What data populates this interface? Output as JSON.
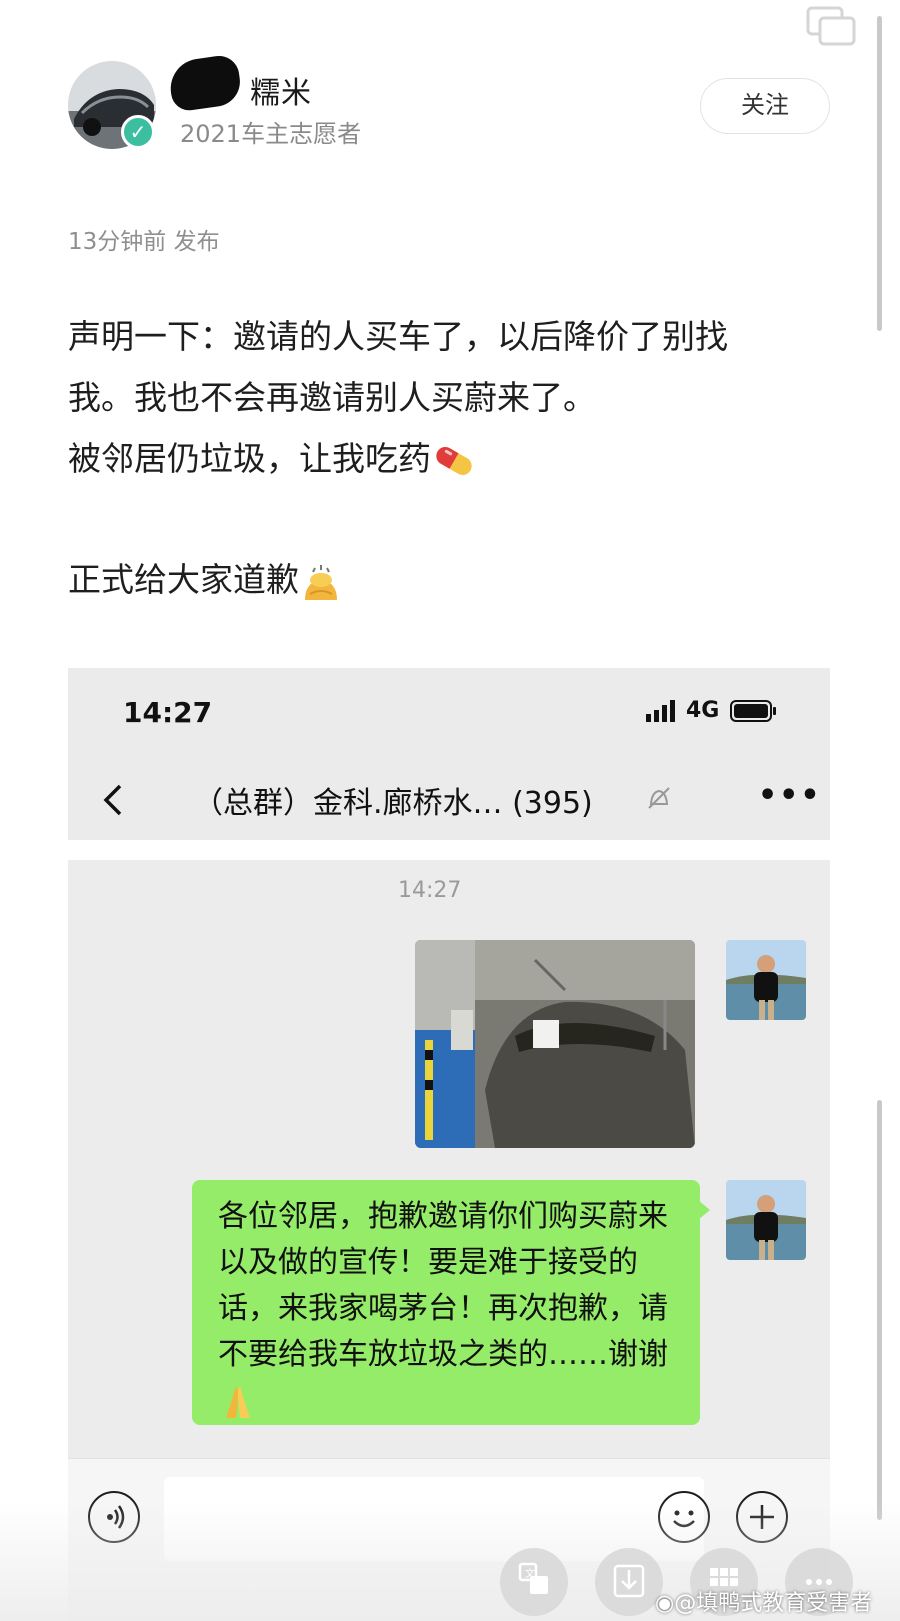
{
  "author": {
    "name_visible": "糯米",
    "subtitle": "2021车主志愿者",
    "follow_label": "关注"
  },
  "post": {
    "time": "13分钟前 发布",
    "lines": [
      "声明一下：邀请的人买车了，以后降价了别找",
      "我。我也不会再邀请别人买蔚来了。",
      "被邻居仍垃圾，让我吃药"
    ],
    "closing": "正式给大家道歉",
    "emojis": [
      "pill-emoji",
      "bowing-person-emoji"
    ]
  },
  "screenshot": {
    "status_time": "14:27",
    "network": "4G",
    "chat_title": "（总群）金科.廊桥水…  (395)",
    "more": "•••",
    "timestamp": "14:27",
    "message_text": "各位邻居，抱歉邀请你们购买蔚来以及做的宣传！要是难于接受的话，来我家喝茅台！再次抱歉，请不要给我车放垃圾之类的……谢谢",
    "message_emoji": "folded-hands-emoji"
  },
  "watermark": "@填鸭式教育受害者",
  "colors": {
    "bubble_green": "#95ec69",
    "verified_teal": "#3bbfa0",
    "chat_bg": "#ececec"
  }
}
